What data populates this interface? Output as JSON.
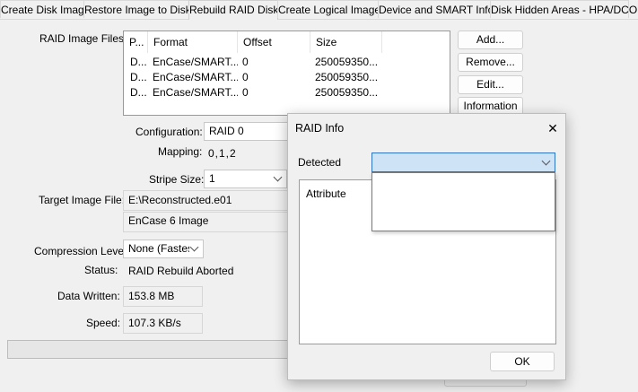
{
  "tabs": [
    {
      "label": "Create Disk Image"
    },
    {
      "label": "Restore Image to Disk"
    },
    {
      "label": "Rebuild RAID Disk"
    },
    {
      "label": "Create Logical Image"
    },
    {
      "label": "Device and SMART Info"
    },
    {
      "label": "Disk Hidden Areas - HPA/DCO"
    }
  ],
  "raid_files": {
    "label": "RAID Image Files:",
    "columns": [
      "P...",
      "Format",
      "Offset",
      "Size"
    ],
    "rows": [
      {
        "p": "D...",
        "format": "EnCase/SMART...",
        "offset": "0",
        "size": "250059350..."
      },
      {
        "p": "D...",
        "format": "EnCase/SMART...",
        "offset": "0",
        "size": "250059350..."
      },
      {
        "p": "D...",
        "format": "EnCase/SMART...",
        "offset": "0",
        "size": "250059350..."
      }
    ],
    "buttons": {
      "add": "Add...",
      "remove": "Remove...",
      "edit": "Edit...",
      "information": "Information"
    }
  },
  "form": {
    "configuration_label": "Configuration:",
    "configuration_value": "RAID 0",
    "mapping_label": "Mapping:",
    "mapping_value": "0,1,2",
    "stripe_label": "Stripe Size:",
    "stripe_value": "1",
    "target_label": "Target Image File:",
    "target_value": "E:\\Reconstructed.e01",
    "image_format": "EnCase 6 Image",
    "compression_label": "Compression Level:",
    "compression_value": "None (Fastest",
    "status_label": "Status:",
    "status_value": "RAID Rebuild Aborted",
    "data_written_label": "Data Written:",
    "data_written_value": "153.8 MB",
    "speed_label": "Speed:",
    "speed_value": "107.3 KB/s"
  },
  "dialog": {
    "title": "RAID Info",
    "close_glyph": "✕",
    "detected_label": "Detected",
    "detected_value": "",
    "attribute_header": "Attribute",
    "ok_label": "OK"
  }
}
